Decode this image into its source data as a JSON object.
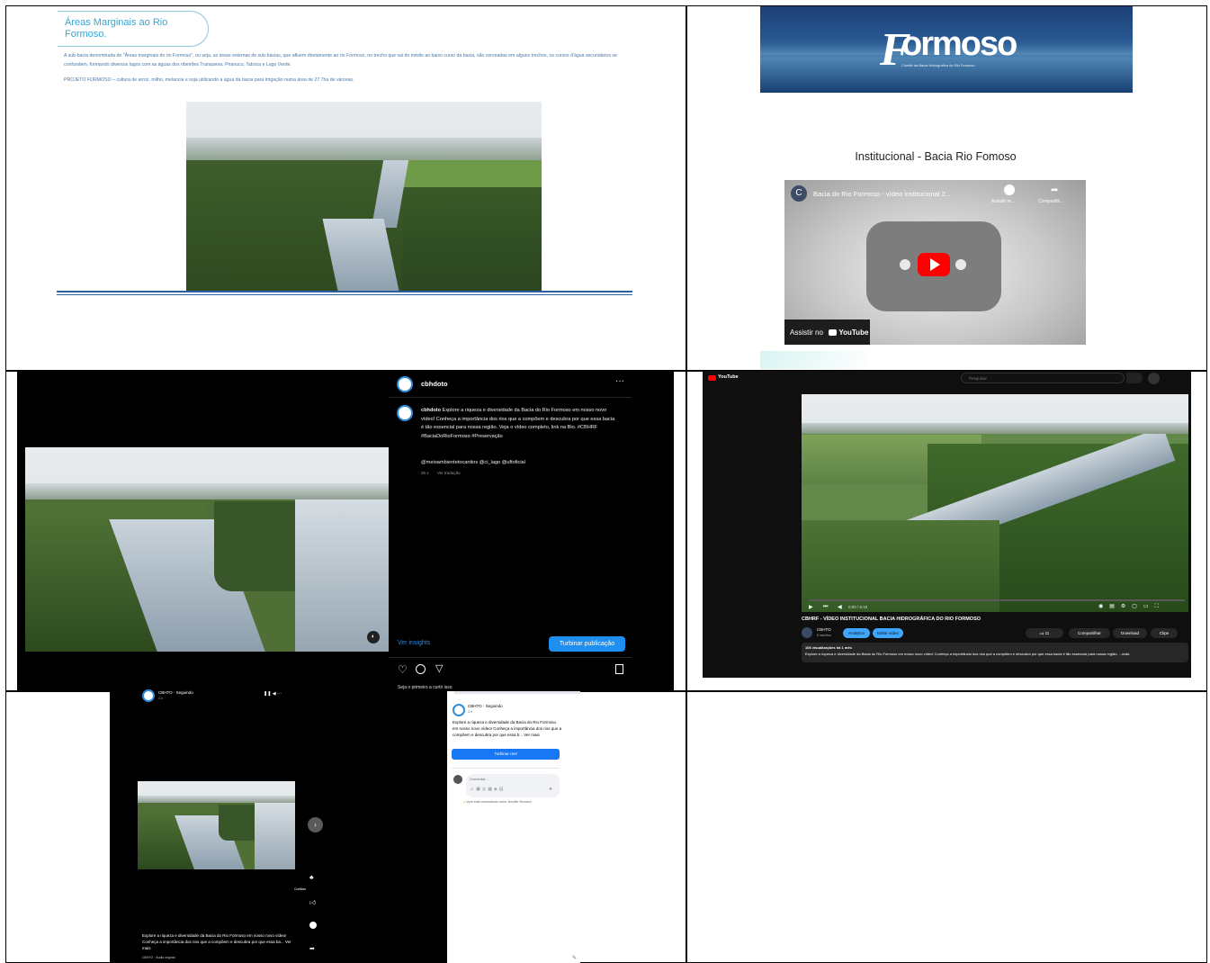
{
  "cell1": {
    "title": "Áreas Marginais ao Rio Formoso.",
    "paragraph1": "A sub-bacia denominada de \"Áreas marginais do rio Formoso\", ou seja, as áreas externas de sub-bacias, que afluem diretamente ao rio Formoso, no trecho que vai do médio ao baixo curso da bacia, são cerceadas em alguns trechos, os cursos d'água secundários se confundem, formando diversos lagos com as águas dos ribeirões Tranqueira, Piranucu, Taboca e Lago Verde.",
    "paragraph2": "PROJETO FORMOSO – cultura de arroz, milho, melancia e soja utilizando a água da bacia para irrigação numa área de 27.7ha de várzeas."
  },
  "cell2": {
    "logo_text": "ormoso",
    "logo_letter": "F",
    "logo_subtitle": "Comitê da Bacia Hidrográfica do Rio Formoso",
    "heading": "Institucional - Bacia Rio Fomoso",
    "player": {
      "channel_initial": "C",
      "video_title": "Bacia do Rio Formoso - vídeo institucional 2...",
      "watch_later": "Assistir m...",
      "share": "Compartilh...",
      "watch_on": "Assistir no",
      "youtube": "YouTube"
    }
  },
  "cell3": {
    "username": "cbhdoto",
    "caption_user": "cbhdoto",
    "caption": "Explore a riqueza e diversidade da Bacia do Rio Formoso em nosso novo vídeo! Conheça a importância dos rios que a compõem e descubra por que essa bacia é tão essencial para nossa região. Veja o vídeo completo, link na Bio. #CBHRF #BaciaDoRioFormoso #Preservação",
    "mentions": "@meioambientetocantins @ci_lago @uftoficial",
    "meta_time": "26 s",
    "meta_translate": "Ver tradução",
    "insights_link": "Ver insights",
    "boost_button": "Turbinar publicação",
    "footer_text": "Seja o primeiro a curtir isso"
  },
  "cell4": {
    "logo": "YouTube",
    "search_placeholder": "Pesquisar",
    "time": "0:00 / 6:15",
    "video_title": "CBHRF - VÍDEO INSTITUCIONAL BACIA HIDROGRÁFICA DO RIO FORMOSO",
    "channel_name": "CBHTO",
    "channel_subs": "8 inscritos",
    "analytics_btn": "Analytics",
    "edit_btn": "Editar vídeo",
    "likes": "11",
    "share": "Compartilhar",
    "download": "Download",
    "clip": "Clipe",
    "views": "106 visualizações há 1 mês",
    "description": "Explore a riqueza e diversidade da Bacia do Rio Formoso em nosso novo vídeo! Conheça a importância dos rios que a compõem e descubra por que essa bacia é tão essencial para nossa região. ...mais"
  },
  "cell5": {
    "page_name": "CBHTO · Seguindo",
    "page_sub": "4 h",
    "post_text": "Explore a riqueza e diversidade da Bacia do Rio Formoso em nosso novo vídeo! Conheça a importância dos rios que a compõem e descubra por que essa ba... Ver mais",
    "audio": "CBHTO · Áudio original",
    "side_name": "CBHTO · Seguindo",
    "side_time": "4 h",
    "side_text": "Explore a riqueza e diversidade da Bacia do Rio Formoso em nosso novo vídeo! Conheça a importância dos rios que a compõem e descubra por que essa b... Ver mais",
    "boost_reel": "Turbinar reel",
    "comment_placeholder": "Comentar...",
    "side_note": "Você está comentando como Jennifer Brusarol",
    "reaction_label": "Curtidas"
  },
  "colors": {
    "instagram_blue": "#1f8ef1",
    "youtube_red": "#ff0000",
    "facebook_blue": "#1877f2",
    "doc_blue": "#38a5d0"
  }
}
